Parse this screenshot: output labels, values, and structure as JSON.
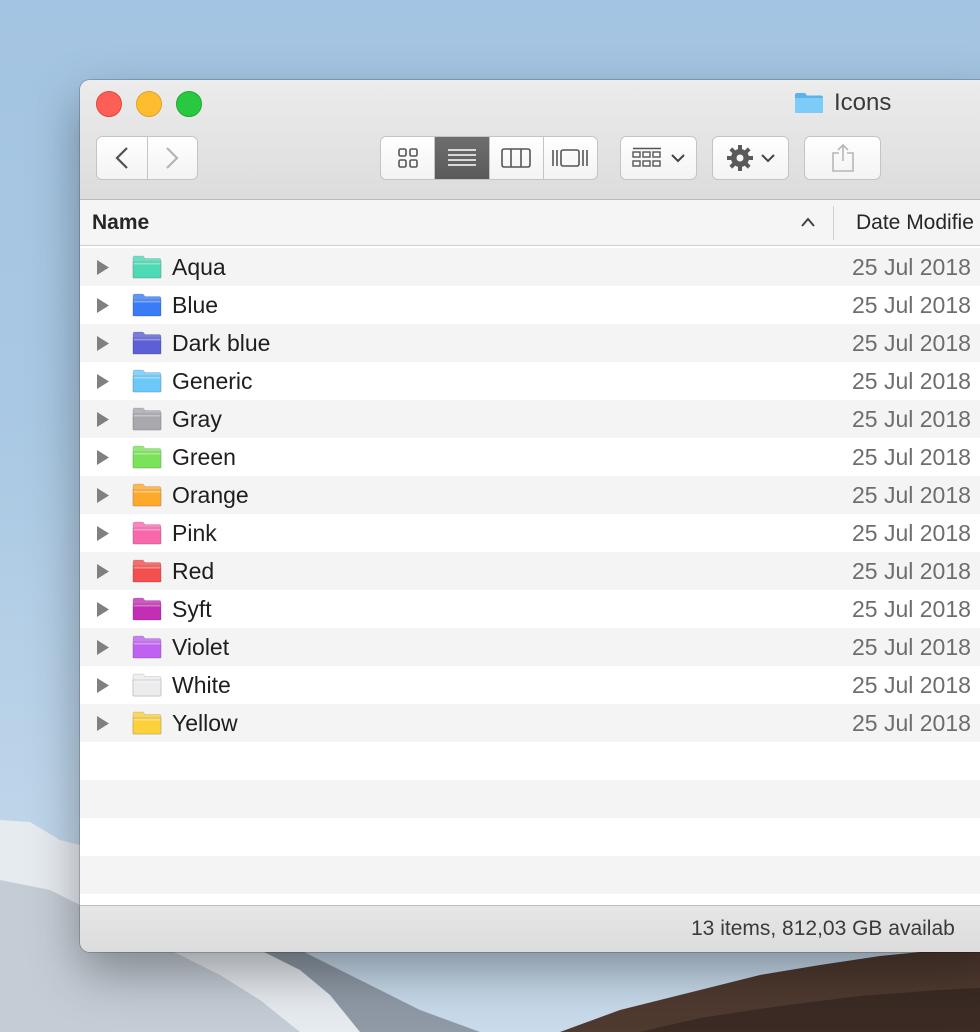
{
  "window": {
    "title": "Icons"
  },
  "toolbar": {
    "back_icon": "chevron-left-icon",
    "forward_icon": "chevron-right-icon",
    "views": [
      "icon-view",
      "list-view",
      "column-view",
      "gallery-view"
    ],
    "active_view": "list-view",
    "group_icon": "group-by-icon",
    "action_icon": "gear-icon",
    "share_icon": "share-icon"
  },
  "columns": {
    "name": "Name",
    "date": "Date Modifie"
  },
  "files": [
    {
      "name": "Aqua",
      "date": "25 Jul 2018",
      "color": "#4fdab6"
    },
    {
      "name": "Blue",
      "date": "25 Jul 2018",
      "color": "#3a7cf5"
    },
    {
      "name": "Dark blue",
      "date": "25 Jul 2018",
      "color": "#5c5fd6"
    },
    {
      "name": "Generic",
      "date": "25 Jul 2018",
      "color": "#6cc8f8"
    },
    {
      "name": "Gray",
      "date": "25 Jul 2018",
      "color": "#a8a8ad"
    },
    {
      "name": "Green",
      "date": "25 Jul 2018",
      "color": "#7ae35a"
    },
    {
      "name": "Orange",
      "date": "25 Jul 2018",
      "color": "#fdaa2c"
    },
    {
      "name": "Pink",
      "date": "25 Jul 2018",
      "color": "#f868ac"
    },
    {
      "name": "Red",
      "date": "25 Jul 2018",
      "color": "#f44f4f"
    },
    {
      "name": "Syft",
      "date": "25 Jul 2018",
      "color": "#c22eb4"
    },
    {
      "name": "Violet",
      "date": "25 Jul 2018",
      "color": "#c062f1"
    },
    {
      "name": "White",
      "date": "25 Jul 2018",
      "color": "#ececee"
    },
    {
      "name": "Yellow",
      "date": "25 Jul 2018",
      "color": "#fcd13c"
    }
  ],
  "empty_rows": 4,
  "status": "13 items, 812,03 GB availab"
}
